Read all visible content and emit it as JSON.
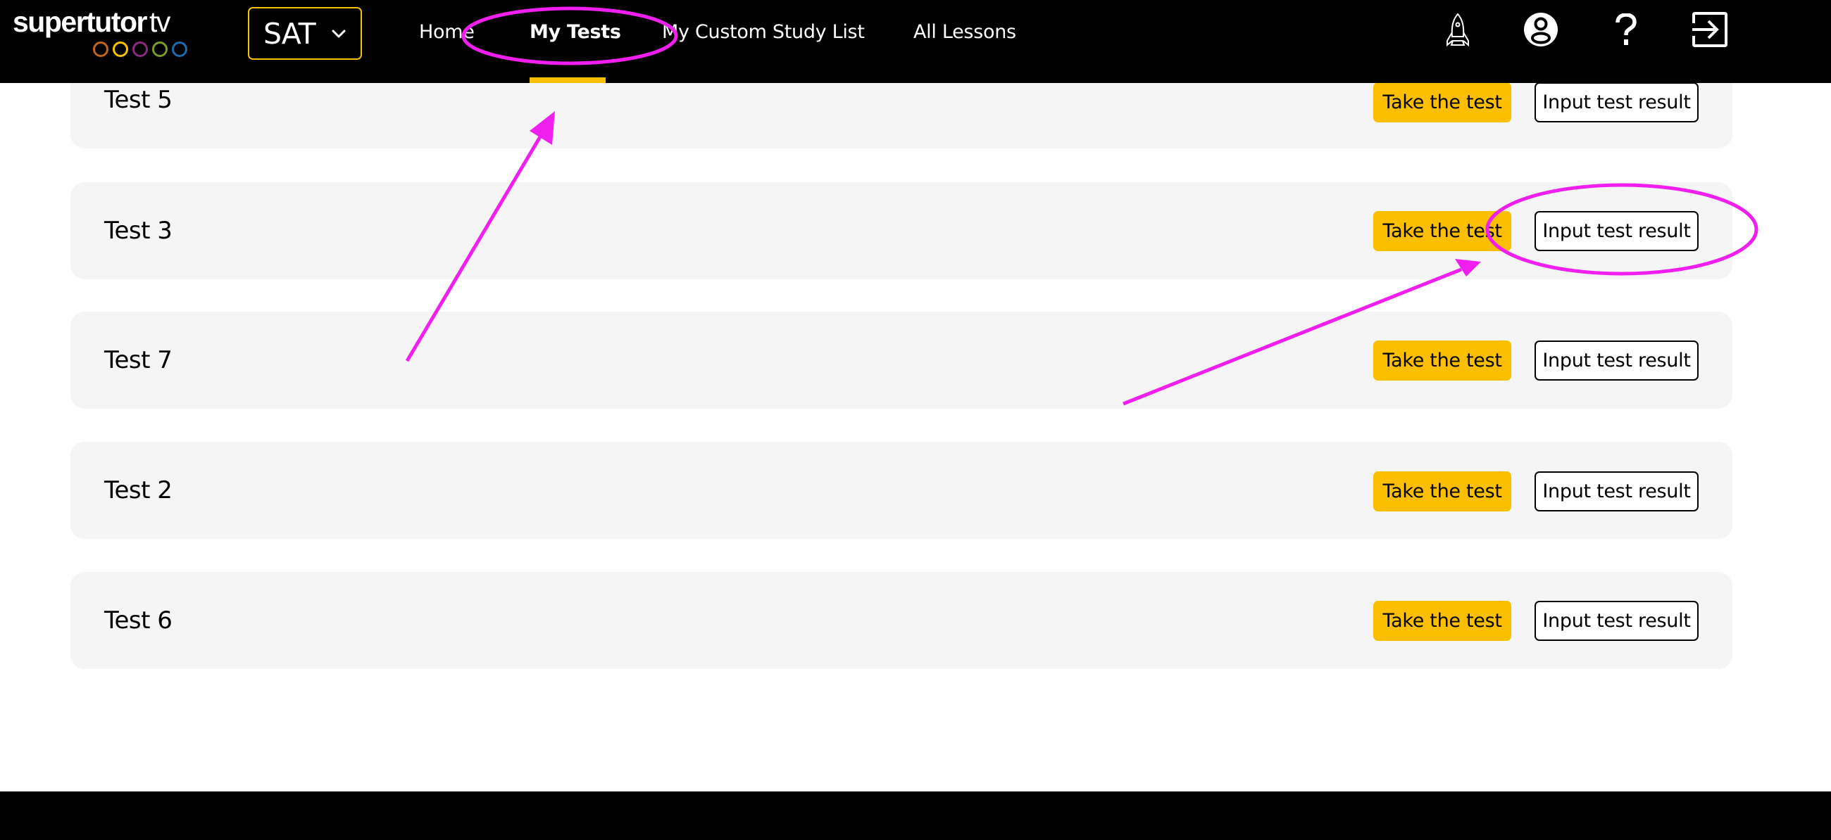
{
  "brand": {
    "name_bold": "supertutor",
    "name_thin": "tv",
    "ring_colors": [
      "#c0651e",
      "#f7c200",
      "#8a2a7e",
      "#7a9a2a",
      "#1e6aaa"
    ]
  },
  "exam_selector": {
    "value": "SAT",
    "icon": "chevron-down-icon"
  },
  "nav": {
    "items": [
      {
        "label": "Home",
        "active": false
      },
      {
        "label": "My Tests",
        "active": true
      },
      {
        "label": "My Custom Study List",
        "active": false
      },
      {
        "label": "All Lessons",
        "active": false
      }
    ]
  },
  "header_icons": [
    "rocket-icon",
    "user-account-icon",
    "help-icon",
    "logout-icon"
  ],
  "tests": [
    {
      "name": "Test 5",
      "take_label": "Take the test",
      "input_label": "Input test result"
    },
    {
      "name": "Test 3",
      "take_label": "Take the test",
      "input_label": "Input test result"
    },
    {
      "name": "Test 7",
      "take_label": "Take the test",
      "input_label": "Input test result"
    },
    {
      "name": "Test 2",
      "take_label": "Take the test",
      "input_label": "Input test result"
    },
    {
      "name": "Test 6",
      "take_label": "Take the test",
      "input_label": "Input test result"
    }
  ],
  "colors": {
    "accent": "#fbbf00",
    "header_bg": "#000000",
    "row_bg": "#f5f5f5",
    "annotation": "#f01ff0"
  }
}
